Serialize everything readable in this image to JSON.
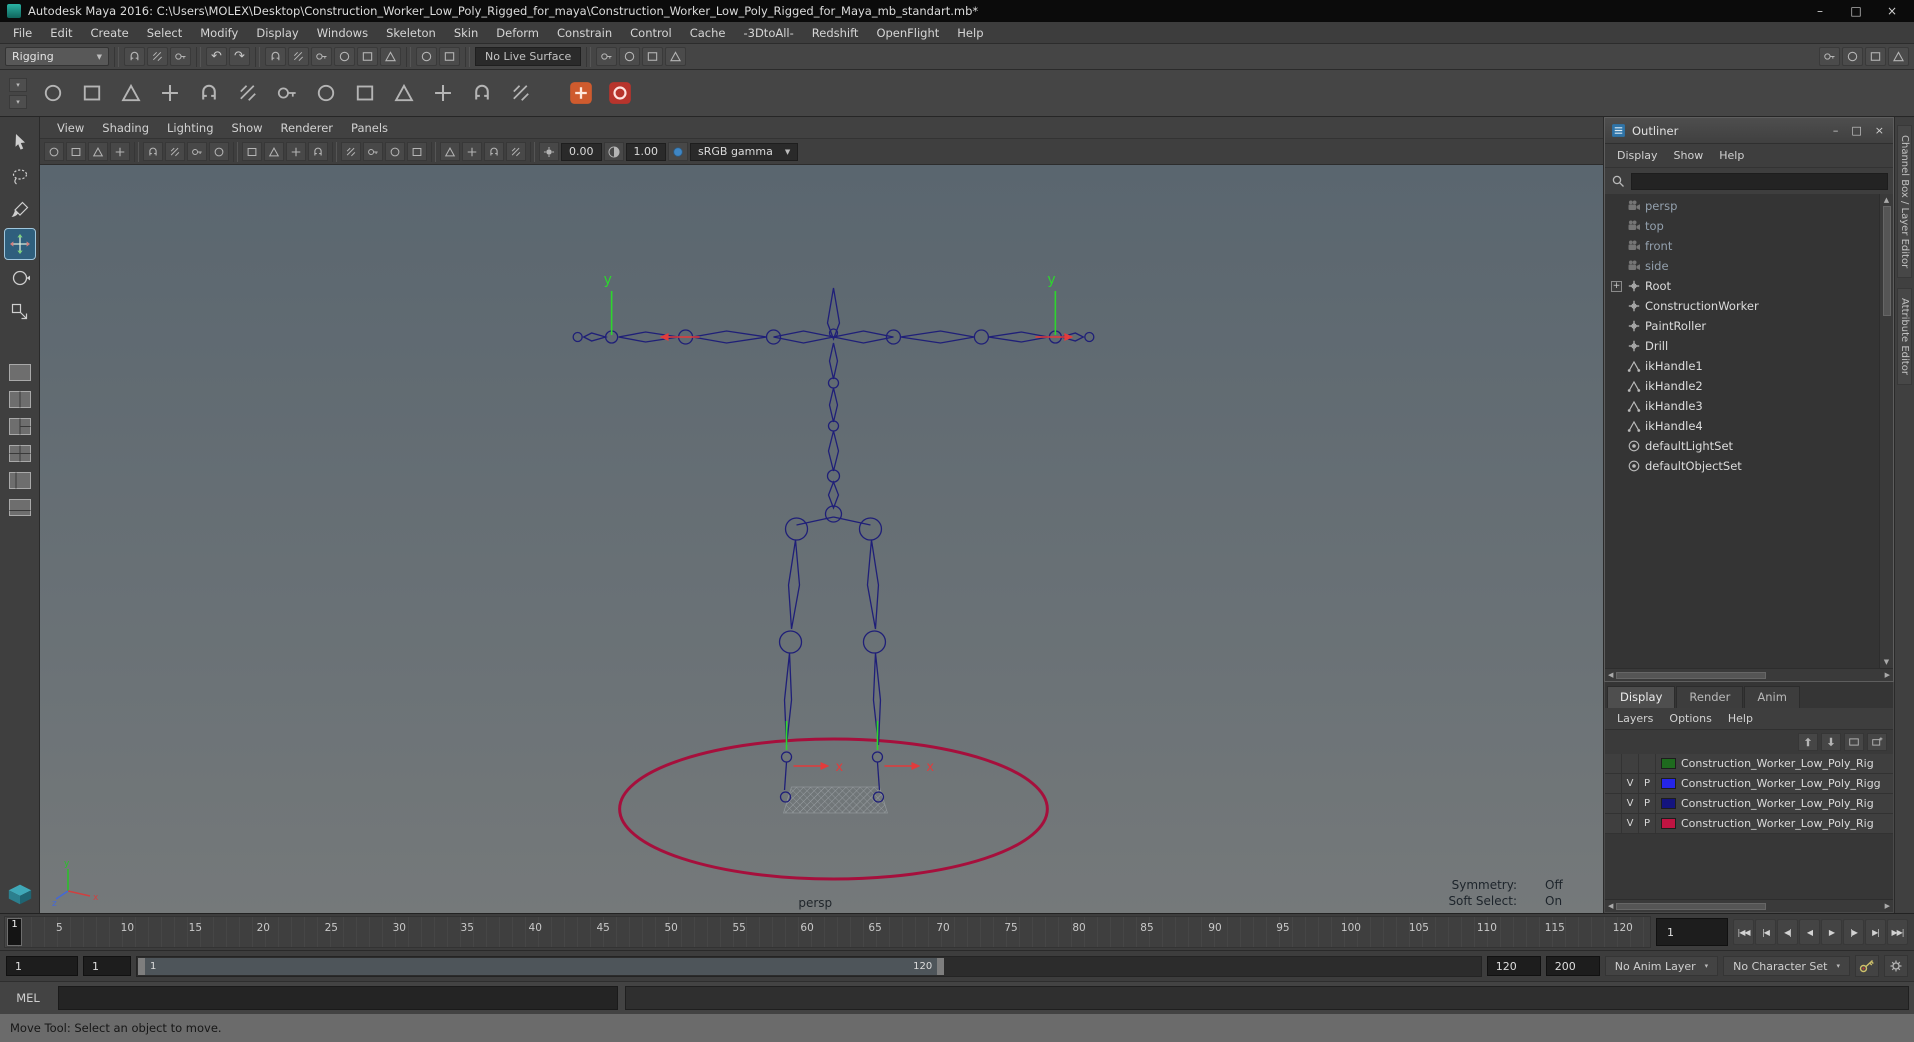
{
  "window": {
    "title": "Autodesk Maya 2016: C:\\Users\\MOLEX\\Desktop\\Construction_Worker_Low_Poly_Rigged_for_maya\\Construction_Worker_Low_Poly_Rigged_for_Maya_mb_standart.mb*",
    "controls": {
      "minimize": "–",
      "maximize": "□",
      "close": "×"
    }
  },
  "menubar": {
    "items": [
      "File",
      "Edit",
      "Create",
      "Select",
      "Modify",
      "Display",
      "Windows",
      "Skeleton",
      "Skin",
      "Deform",
      "Constrain",
      "Control",
      "Cache",
      "-3DtoAll-",
      "Redshift",
      "OpenFlight",
      "Help"
    ]
  },
  "statusline": {
    "mode": "Rigging",
    "live_surface": "No Live Surface",
    "icon_groups": {
      "file": [
        "new-scene",
        "open-scene",
        "save-scene"
      ],
      "undo": [
        "undo",
        "redo"
      ],
      "snap": [
        "snap-to-grid",
        "snap-to-curve",
        "snap-to-point",
        "snap-to-projected-center",
        "snap-to-view-plane",
        "make-live"
      ],
      "history": [
        "construction-history",
        "list-input-operations"
      ],
      "render": [
        "open-render-view",
        "render-current-frame",
        "ipr-render",
        "render-settings"
      ],
      "panels": [
        "raise-main-window",
        "toggle-channel-box",
        "toggle-attribute-editor",
        "toggle-tool-settings"
      ]
    }
  },
  "shelf": {
    "side": [
      "shelf-tabs-toggle",
      "shelf-menu-toggle"
    ],
    "icons": [
      "joint-tool",
      "ik-handle-tool",
      "ik-spline-handle-tool",
      "insert-joint-tool",
      "reroot-skeleton",
      "mirror-joint",
      "orient-joint",
      "bind-skin",
      "detach-skin",
      "paint-skin-weights",
      "mirror-skin-weights",
      "copy-skin-weights",
      "create-constraint"
    ],
    "plugin_icons": [
      "plugin-tool-a",
      "plugin-tool-b"
    ]
  },
  "toolbox": {
    "tools": [
      "select-tool",
      "lasso-tool",
      "paint-select-tool",
      "move-tool",
      "rotate-tool",
      "scale-tool"
    ],
    "selected": "move-tool",
    "layouts": [
      "layout-single-pane",
      "layout-two-pane",
      "layout-three-pane",
      "layout-four-pane",
      "layout-left-split",
      "layout-bottom-split"
    ]
  },
  "viewport": {
    "menu": [
      "View",
      "Shading",
      "Lighting",
      "Show",
      "Renderer",
      "Panels"
    ],
    "toolbar": {
      "icons": [
        "select-camera",
        "lock-camera",
        "camera-attributes",
        "bookmark-view",
        "image-plane",
        "2d-pan-zoom",
        "grease-pencil",
        "grid-toggle",
        "film-gate",
        "resolution-gate",
        "gate-mask",
        "field-chart",
        "safe-action",
        "safe-title",
        "wireframe-display",
        "shaded-display",
        "textured-display",
        "use-all-lights",
        "shadows-toggle",
        "screen-space-ao"
      ],
      "exposure": "0.00",
      "gamma": "1.00",
      "view_transform": "sRGB gamma"
    },
    "camera": "persp",
    "hud": {
      "symmetry_label": "Symmetry:",
      "symmetry_value": "Off",
      "soft_select_label": "Soft Select:",
      "soft_select_value": "On"
    },
    "manipulator": {
      "x": "x",
      "y": "y"
    },
    "axis": {
      "x": "x",
      "y": "y",
      "z": "z"
    }
  },
  "outliner": {
    "title": "Outliner",
    "menu": [
      "Display",
      "Show",
      "Help"
    ],
    "items": [
      {
        "label": "persp",
        "icon": "camera",
        "dimmed": true
      },
      {
        "label": "top",
        "icon": "camera",
        "dimmed": true
      },
      {
        "label": "front",
        "icon": "camera",
        "dimmed": true
      },
      {
        "label": "side",
        "icon": "camera",
        "dimmed": true
      },
      {
        "label": "Root",
        "icon": "transform",
        "expandable": true
      },
      {
        "label": "ConstructionWorker",
        "icon": "transform"
      },
      {
        "label": "PaintRoller",
        "icon": "transform"
      },
      {
        "label": "Drill",
        "icon": "transform"
      },
      {
        "label": "ikHandle1",
        "icon": "ik-handle"
      },
      {
        "label": "ikHandle2",
        "icon": "ik-handle"
      },
      {
        "label": "ikHandle3",
        "icon": "ik-handle"
      },
      {
        "label": "ikHandle4",
        "icon": "ik-handle"
      },
      {
        "label": "defaultLightSet",
        "icon": "object-set"
      },
      {
        "label": "defaultObjectSet",
        "icon": "object-set"
      }
    ]
  },
  "layer_editor": {
    "tabs": [
      "Display",
      "Render",
      "Anim"
    ],
    "active_tab": "Display",
    "menu": [
      "Layers",
      "Options",
      "Help"
    ],
    "toolbar": [
      "move-layer-up",
      "move-layer-down",
      "create-empty-layer",
      "create-layer-from-selected"
    ],
    "layers": [
      {
        "visible": "",
        "playback": "",
        "color": "#1e6a1e",
        "name": "Construction_Worker_Low_Poly_Rig"
      },
      {
        "visible": "V",
        "playback": "P",
        "color": "#2525e8",
        "name": "Construction_Worker_Low_Poly_Rigg"
      },
      {
        "visible": "V",
        "playback": "P",
        "color": "#14147e",
        "name": "Construction_Worker_Low_Poly_Rig"
      },
      {
        "visible": "V",
        "playback": "P",
        "color": "#bf1442",
        "name": "Construction_Worker_Low_Poly_Rig"
      }
    ]
  },
  "side_tabs": [
    "Channel Box / Layer Editor",
    "Attribute Editor"
  ],
  "timeline": {
    "current_marker": "1",
    "ticks": [
      5,
      10,
      15,
      20,
      25,
      30,
      35,
      40,
      45,
      50,
      55,
      60,
      65,
      70,
      75,
      80,
      85,
      90,
      95,
      100,
      105,
      110,
      115,
      120
    ],
    "current_frame_field": "1",
    "playback": [
      {
        "name": "go-to-start",
        "glyph": "|◀◀"
      },
      {
        "name": "step-back-key",
        "glyph": "|◀"
      },
      {
        "name": "step-back-frame",
        "glyph": "◀|"
      },
      {
        "name": "play-backward",
        "glyph": "◀"
      },
      {
        "name": "play-forward",
        "glyph": "▶"
      },
      {
        "name": "step-forward-frame",
        "glyph": "|▶"
      },
      {
        "name": "step-forward-key",
        "glyph": "▶|"
      },
      {
        "name": "go-to-end",
        "glyph": "▶▶|"
      }
    ]
  },
  "range_slider": {
    "animation_start": "1",
    "playback_start": "1",
    "bar_start": "1",
    "bar_end": "120",
    "playback_end": "120",
    "animation_end": "200",
    "anim_layer": "No Anim Layer",
    "character_set": "No Character Set"
  },
  "command_line": {
    "label": "MEL"
  },
  "help_line": {
    "text": "Move Tool: Select an object to move."
  }
}
